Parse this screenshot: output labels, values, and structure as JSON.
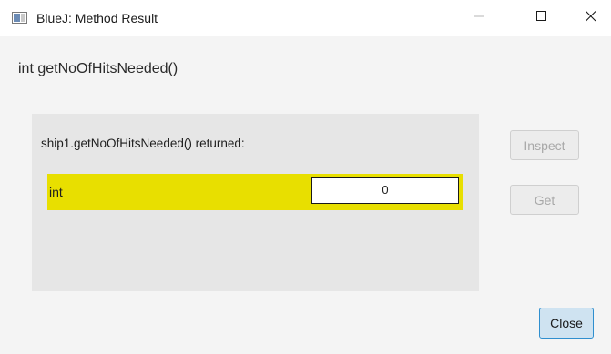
{
  "window": {
    "title": "BlueJ:  Method Result",
    "icons": {
      "app": "bluej-window-icon",
      "minimize": "minimize-icon",
      "maximize": "maximize-icon",
      "close": "close-icon"
    }
  },
  "dialog": {
    "method_signature": "int getNoOfHitsNeeded()",
    "result_label": "ship1.getNoOfHitsNeeded() returned:",
    "result_type": "int",
    "result_value": "0"
  },
  "buttons": {
    "inspect": {
      "label": "Inspect",
      "enabled": false
    },
    "get": {
      "label": "Get",
      "enabled": false
    },
    "close": {
      "label": "Close",
      "enabled": true
    }
  },
  "colors": {
    "highlight": "#e8df00",
    "panel": "#e6e6e6",
    "close_button_border": "#2f8fcf",
    "close_button_fill": "#cfe3f1"
  }
}
